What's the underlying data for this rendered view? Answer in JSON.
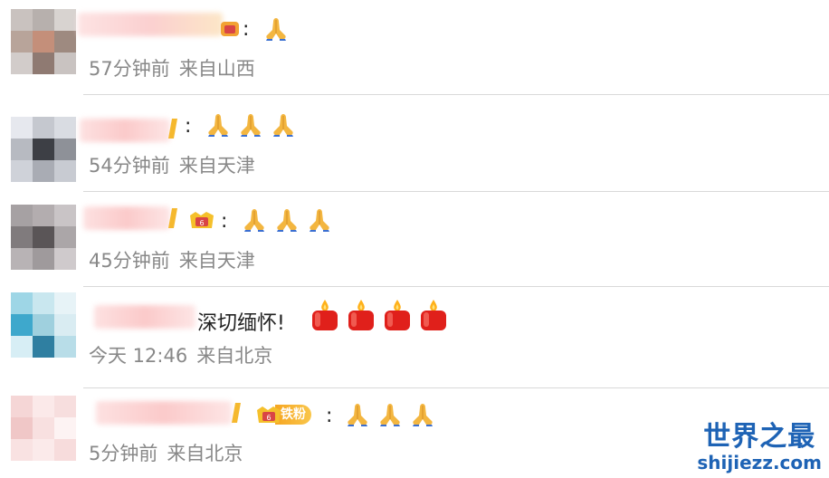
{
  "comments": [
    {
      "meta_time": "57分钟前",
      "meta_location": "来自山西",
      "colon": ":",
      "text": "",
      "emoji_count": 1,
      "emoji": "pray-emoji"
    },
    {
      "meta_time": "54分钟前",
      "meta_location": "来自天津",
      "colon": ":",
      "text": "",
      "emoji_count": 3,
      "emoji": "pray-emoji"
    },
    {
      "meta_time": "45分钟前",
      "meta_location": "来自天津",
      "colon": ":",
      "text": "",
      "emoji_count": 3,
      "emoji": "pray-emoji"
    },
    {
      "meta_time": "今天 12:46",
      "meta_location": "来自北京",
      "colon": "",
      "text": "深切缅怀!",
      "emoji_count": 4,
      "emoji": "candle-emoji"
    },
    {
      "meta_time": "5分钟前",
      "meta_location": "来自北京",
      "colon": ":",
      "text": "",
      "emoji_count": 3,
      "emoji": "pray-emoji",
      "fan_badge": "铁粉"
    }
  ],
  "watermark": {
    "title": "世界之最",
    "url": "shijiezz.com"
  },
  "colors": {
    "meta_text": "#888888",
    "divider": "#d9d9d9",
    "badge_gold": "#f6a623",
    "watermark_blue": "#1e63b5"
  }
}
